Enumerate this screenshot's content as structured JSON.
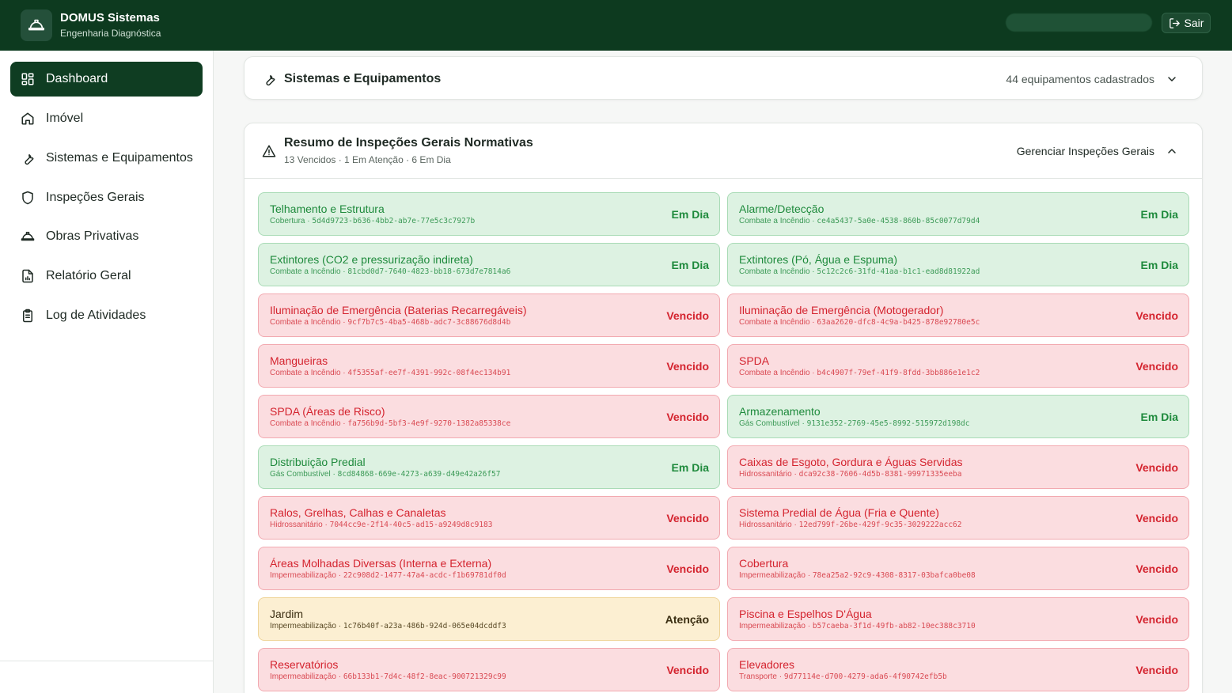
{
  "header": {
    "brand_name": "DOMUS Sistemas",
    "brand_subtitle": "Engenharia Diagnóstica",
    "logout_label": "Sair",
    "logo_icon": "hard-hat-icon"
  },
  "sidebar": {
    "items": [
      {
        "label": "Dashboard",
        "icon": "grid-icon",
        "active": true
      },
      {
        "label": "Imóvel",
        "icon": "home-icon"
      },
      {
        "label": "Sistemas e Equipamentos",
        "icon": "wrench-icon"
      },
      {
        "label": "Inspeções Gerais",
        "icon": "shield-icon"
      },
      {
        "label": "Obras Privativas",
        "icon": "hard-hat-icon"
      },
      {
        "label": "Relatório Geral",
        "icon": "report-icon"
      },
      {
        "label": "Log de Atividades",
        "icon": "clipboard-icon"
      }
    ]
  },
  "equipment": {
    "title": "Sistemas e Equipamentos",
    "count_text": "44 equipamentos cadastrados"
  },
  "inspections": {
    "title": "Resumo de Inspeções Gerais Normativas",
    "summary": "13 Vencidos · 1 Em Atenção · 6 Em Dia",
    "manage_label": "Gerenciar Inspeções Gerais",
    "colors": {
      "ok": "#1e8a3c",
      "late": "#d4242f",
      "warn": "#3b2e12"
    },
    "items": [
      {
        "name": "Telhamento e Estrutura",
        "category": "Cobertura",
        "id": "5d4d9723-b636-4bb2-ab7e-77e5c3c7927b",
        "status": "Em Dia",
        "level": "ok"
      },
      {
        "name": "Alarme/Detecção",
        "category": "Combate a Incêndio",
        "id": "ce4a5437-5a0e-4538-860b-85c0077d79d4",
        "status": "Em Dia",
        "level": "ok"
      },
      {
        "name": "Extintores (CO2 e pressurização indireta)",
        "category": "Combate a Incêndio",
        "id": "81cbd0d7-7640-4823-bb18-673d7e7814a6",
        "status": "Em Dia",
        "level": "ok"
      },
      {
        "name": "Extintores (Pó, Água e Espuma)",
        "category": "Combate a Incêndio",
        "id": "5c12c2c6-31fd-41aa-b1c1-ead8d81922ad",
        "status": "Em Dia",
        "level": "ok"
      },
      {
        "name": "Iluminação de Emergência (Baterias Recarregáveis)",
        "category": "Combate a Incêndio",
        "id": "9cf7b7c5-4ba5-468b-adc7-3c88676d8d4b",
        "status": "Vencido",
        "level": "late"
      },
      {
        "name": "Iluminação de Emergência (Motogerador)",
        "category": "Combate a Incêndio",
        "id": "63aa2620-dfc8-4c9a-b425-878e92780e5c",
        "status": "Vencido",
        "level": "late"
      },
      {
        "name": "Mangueiras",
        "category": "Combate a Incêndio",
        "id": "4f5355af-ee7f-4391-992c-08f4ec134b91",
        "status": "Vencido",
        "level": "late"
      },
      {
        "name": "SPDA",
        "category": "Combate a Incêndio",
        "id": "b4c4907f-79ef-41f9-8fdd-3bb886e1e1c2",
        "status": "Vencido",
        "level": "late"
      },
      {
        "name": "SPDA (Áreas de Risco)",
        "category": "Combate a Incêndio",
        "id": "fa756b9d-5bf3-4e9f-9270-1382a85338ce",
        "status": "Vencido",
        "level": "late"
      },
      {
        "name": "Armazenamento",
        "category": "Gás Combustível",
        "id": "9131e352-2769-45e5-8992-515972d198dc",
        "status": "Em Dia",
        "level": "ok"
      },
      {
        "name": "Distribuição Predial",
        "category": "Gás Combustível",
        "id": "8cd84868-669e-4273-a639-d49e42a26f57",
        "status": "Em Dia",
        "level": "ok"
      },
      {
        "name": "Caixas de Esgoto, Gordura e Águas Servidas",
        "category": "Hidrossanitário",
        "id": "dca92c38-7606-4d5b-8381-99971335eeba",
        "status": "Vencido",
        "level": "late"
      },
      {
        "name": "Ralos, Grelhas, Calhas e Canaletas",
        "category": "Hidrossanitário",
        "id": "7044cc9e-2f14-40c5-ad15-a9249d8c9183",
        "status": "Vencido",
        "level": "late"
      },
      {
        "name": "Sistema Predial de Água (Fria e Quente)",
        "category": "Hidrossanitário",
        "id": "12ed799f-26be-429f-9c35-3029222acc62",
        "status": "Vencido",
        "level": "late"
      },
      {
        "name": "Áreas Molhadas Diversas (Interna e Externa)",
        "category": "Impermeabilização",
        "id": "22c908d2-1477-47a4-acdc-f1b69781df0d",
        "status": "Vencido",
        "level": "late"
      },
      {
        "name": "Cobertura",
        "category": "Impermeabilização",
        "id": "78ea25a2-92c9-4308-8317-03bafca0be08",
        "status": "Vencido",
        "level": "late"
      },
      {
        "name": "Jardim",
        "category": "Impermeabilização",
        "id": "1c76b40f-a23a-486b-924d-065e04dcddf3",
        "status": "Atenção",
        "level": "warn"
      },
      {
        "name": "Piscina e Espelhos D'Água",
        "category": "Impermeabilização",
        "id": "b57caeba-3f1d-49fb-ab82-10ec388c3710",
        "status": "Vencido",
        "level": "late"
      },
      {
        "name": "Reservatórios",
        "category": "Impermeabilização",
        "id": "66b133b1-7d4c-48f2-8eac-900721329c99",
        "status": "Vencido",
        "level": "late"
      },
      {
        "name": "Elevadores",
        "category": "Transporte",
        "id": "9d77114e-d700-4279-ada6-4f90742efb5b",
        "status": "Vencido",
        "level": "late"
      }
    ]
  }
}
